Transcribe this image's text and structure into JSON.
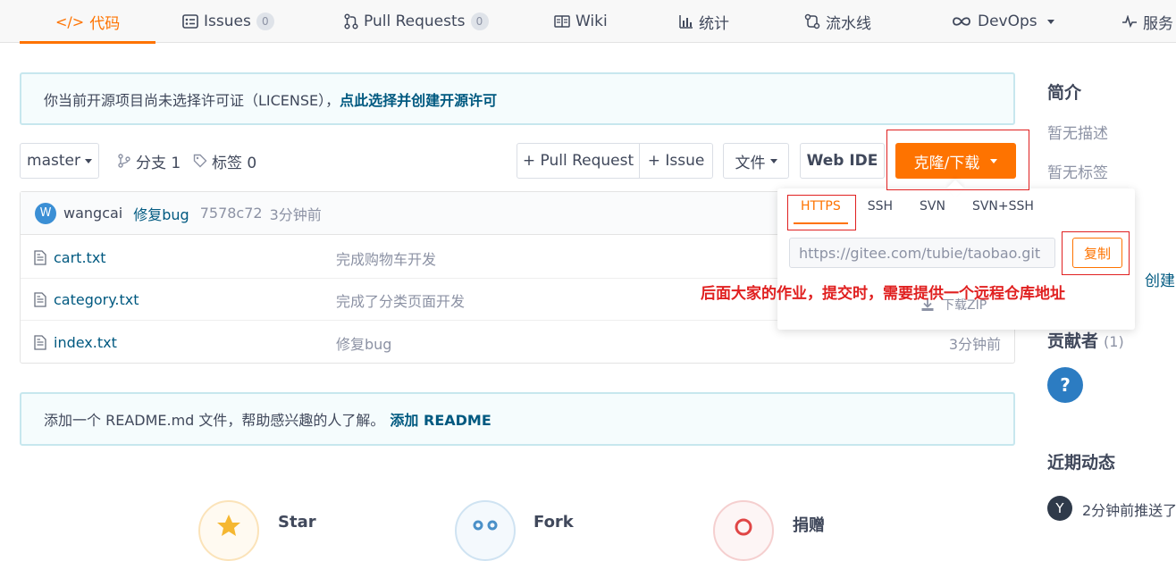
{
  "nav": {
    "tabs": [
      {
        "label": "代码"
      },
      {
        "label": "Issues",
        "badge": "0"
      },
      {
        "label": "Pull Requests",
        "badge": "0"
      },
      {
        "label": "Wiki"
      },
      {
        "label": "统计"
      },
      {
        "label": "流水线"
      },
      {
        "label": "DevOps"
      },
      {
        "label": "服务"
      }
    ],
    "active": "代码"
  },
  "license_notice": {
    "text": "你当前开源项目尚未选择许可证（LICENSE），",
    "link": "点此选择并创建开源许可"
  },
  "toolbar": {
    "branch": "master",
    "branches_label": "分支 1",
    "tags_label": "标签 0",
    "pull_request": "+ Pull Request",
    "issue": "+ Issue",
    "file": "文件",
    "web_ide": "Web IDE",
    "clone": "克隆/下载"
  },
  "commit": {
    "avatar": "W",
    "author": "wangcai",
    "message": "修复bug",
    "hash": "7578c72",
    "time": "3分钟前"
  },
  "files": [
    {
      "name": "cart.txt",
      "message": "完成购物车开发",
      "time": ""
    },
    {
      "name": "category.txt",
      "message": "完成了分类页面开发",
      "time": ""
    },
    {
      "name": "index.txt",
      "message": "修复bug",
      "time": "3分钟前"
    }
  ],
  "clone_panel": {
    "tabs": [
      "HTTPS",
      "SSH",
      "SVN",
      "SVN+SSH"
    ],
    "active": "HTTPS",
    "url": "https://gitee.com/tubie/taobao.git",
    "copy": "复制",
    "zip": "下载ZIP"
  },
  "annotation": "后面大家的作业，提交时，需要提供一个远程仓库地址",
  "readme_notice": {
    "text": "添加一个 README.md 文件，帮助感兴趣的人了解。",
    "link": "添加 README"
  },
  "sidebar": {
    "intro_title": "简介",
    "no_desc": "暂无描述",
    "no_tags": "暂无标签",
    "create_partial": "创建",
    "contributors_title": "贡献者",
    "contributors_count": "(1)",
    "contributor_avatar": "?",
    "activity_title": "近期动态",
    "activity_avatar": "Y",
    "activity_item": "2分钟前推送了"
  },
  "bottom": {
    "star": "Star",
    "fork": "Fork",
    "donate": "捐赠"
  },
  "colors": {
    "accent": "#fe7300",
    "link": "#005980",
    "annotation": "#e02020"
  }
}
